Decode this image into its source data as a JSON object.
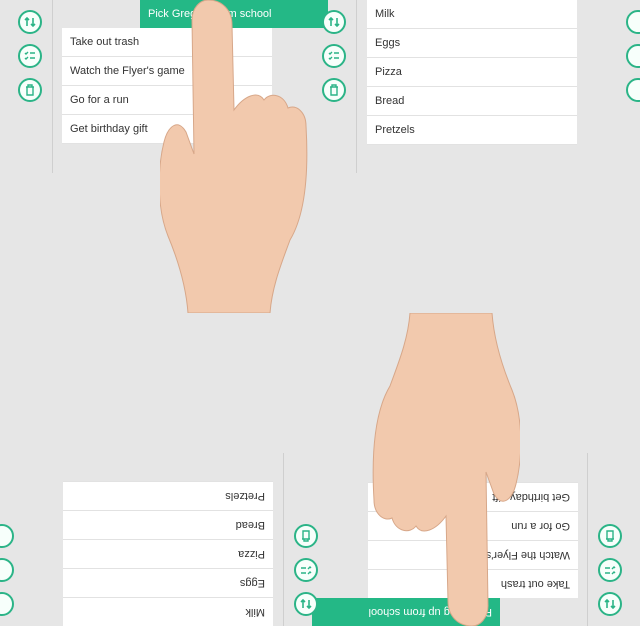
{
  "colors": {
    "accent": "#24b886",
    "background": "#e6e6e6"
  },
  "icons": [
    "reorder-icon",
    "checklist-icon",
    "trash-icon"
  ],
  "left_list": {
    "active_item": "Pick Greg up from school",
    "items": [
      "Take out trash",
      "Watch the Flyer's game",
      "Go for a run",
      "Get birthday gift"
    ]
  },
  "right_list": {
    "items": [
      "Milk",
      "Eggs",
      "Pizza",
      "Bread",
      "Pretzels"
    ]
  }
}
